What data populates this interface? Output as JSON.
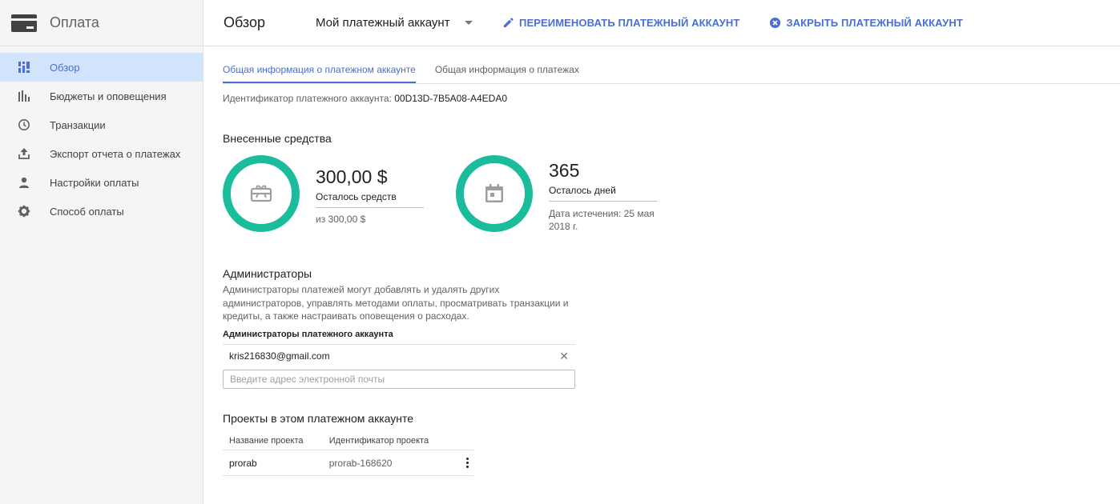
{
  "app": {
    "title": "Оплата"
  },
  "sidebar": {
    "items": [
      {
        "label": "Обзор",
        "icon": "dashboard-icon",
        "active": true
      },
      {
        "label": "Бюджеты и оповещения",
        "icon": "budget-chart-icon"
      },
      {
        "label": "Транзакции",
        "icon": "clock-icon"
      },
      {
        "label": "Экспорт отчета о платежах",
        "icon": "upload-icon"
      },
      {
        "label": "Настройки оплаты",
        "icon": "person-icon"
      },
      {
        "label": "Способ оплаты",
        "icon": "gear-icon"
      }
    ]
  },
  "header": {
    "title": "Обзор",
    "account_select": "Мой платежный аккаунт",
    "rename_label": "ПЕРЕИМЕНОВАТЬ ПЛАТЕЖНЫЙ АККАУНТ",
    "close_label": "ЗАКРЫТЬ ПЛАТЕЖНЫЙ АККАУНТ"
  },
  "tabs": [
    {
      "label": "Общая информация о платежном аккаунте",
      "active": true
    },
    {
      "label": "Общая информация о платежах"
    }
  ],
  "account_id": {
    "label": "Идентификатор платежного аккаунта:",
    "value": "00D13D-7B5A08-A4EDA0"
  },
  "funds": {
    "title": "Внесенные средства",
    "credit": {
      "value": "300,00 $",
      "label": "Осталось средств",
      "sub": "из 300,00 $"
    },
    "days": {
      "value": "365",
      "label": "Осталось дней",
      "sub": "Дата истечения: 25 мая 2018 г."
    }
  },
  "admins": {
    "title": "Администраторы",
    "description": "Администраторы платежей могут добавлять и удалять других администраторов, управлять методами оплаты, просматривать транзакции и кредиты, а также настраивать оповещения о расходах.",
    "subtitle": "Администраторы платежного аккаунта",
    "email": "kris216830@gmail.com",
    "input_placeholder": "Введите адрес электронной почты"
  },
  "projects": {
    "title": "Проекты в этом платежном аккаунте",
    "columns": [
      "Название проекта",
      "Идентификатор проекта"
    ],
    "rows": [
      {
        "name": "prorab",
        "id": "prorab-168620"
      }
    ]
  },
  "colors": {
    "accent": "#4a6fd0",
    "ring": "#1abc9c",
    "sidebar_active": "#d2e3fc"
  }
}
